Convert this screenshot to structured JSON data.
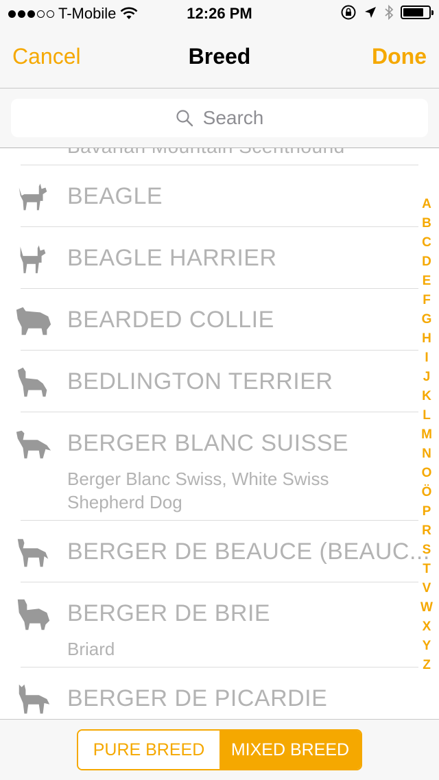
{
  "status_bar": {
    "carrier": "T-Mobile",
    "time": "12:26 PM"
  },
  "nav": {
    "cancel_label": "Cancel",
    "title": "Breed",
    "done_label": "Done"
  },
  "search": {
    "placeholder": "Search"
  },
  "breeds": {
    "partial": "Bavarian Mountain Scenthound",
    "items": [
      {
        "name": "BEAGLE",
        "alias": ""
      },
      {
        "name": "BEAGLE HARRIER",
        "alias": ""
      },
      {
        "name": "BEARDED COLLIE",
        "alias": ""
      },
      {
        "name": "BEDLINGTON TERRIER",
        "alias": ""
      },
      {
        "name": "BERGER BLANC SUISSE",
        "alias_line1": "Berger Blanc Swiss, White Swiss",
        "alias_line2": "Shepherd Dog"
      },
      {
        "name": "BERGER DE BEAUCE (BEAUC...",
        "alias": ""
      },
      {
        "name": "BERGER DE BRIE",
        "alias": "Briard"
      },
      {
        "name": "BERGER DE PICARDIE",
        "alias": ""
      }
    ]
  },
  "index_letters": [
    "A",
    "B",
    "C",
    "D",
    "E",
    "F",
    "G",
    "H",
    "I",
    "J",
    "K",
    "L",
    "M",
    "N",
    "O",
    "Ö",
    "P",
    "R",
    "S",
    "T",
    "V",
    "W",
    "X",
    "Y",
    "Z"
  ],
  "segmented": {
    "pure_label": "PURE BREED",
    "mixed_label": "MIXED BREED",
    "selected": "MIXED BREED"
  },
  "colors": {
    "accent": "#f5a800",
    "list_text": "#b3b3b3",
    "icon": "#999999"
  }
}
